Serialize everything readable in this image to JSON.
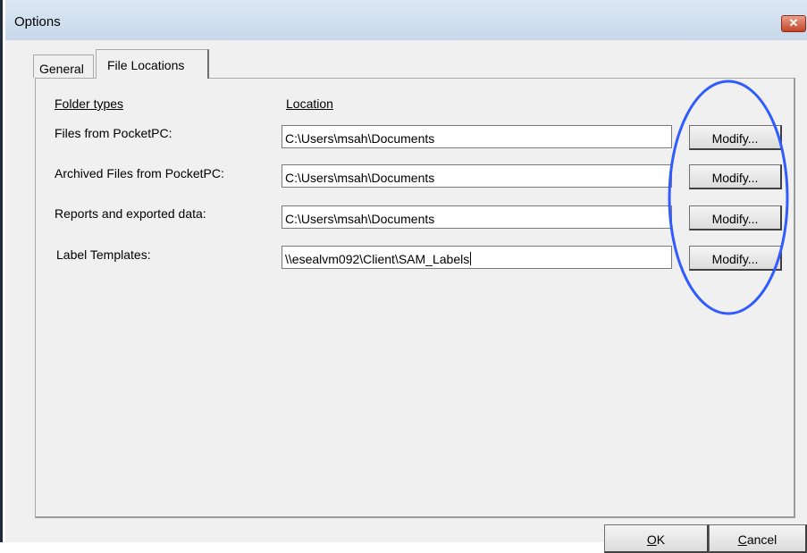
{
  "window": {
    "title": "Options",
    "close_icon": "close-icon"
  },
  "tabs": [
    {
      "label": "General"
    },
    {
      "label": "File Locations"
    }
  ],
  "headers": {
    "folder_types": "Folder types",
    "location": "Location"
  },
  "rows": [
    {
      "label": "Files from PocketPC:",
      "value": "C:\\Users\\msah\\Documents",
      "button": "Modify..."
    },
    {
      "label": "Archived Files from PocketPC:",
      "value": "C:\\Users\\msah\\Documents",
      "button": "Modify..."
    },
    {
      "label": "Reports and exported data:",
      "value": "C:\\Users\\msah\\Documents",
      "button": "Modify..."
    },
    {
      "label": "Label Templates:",
      "value": "\\\\esealvm092\\Client\\SAM_Labels",
      "button": "Modify..."
    }
  ],
  "footer": {
    "ok": {
      "mnemonic": "O",
      "rest": "K"
    },
    "cancel": {
      "mnemonic": "C",
      "rest": "ancel"
    }
  },
  "colors": {
    "annotation": "#2f5bff",
    "close_button": "#c4452a"
  }
}
